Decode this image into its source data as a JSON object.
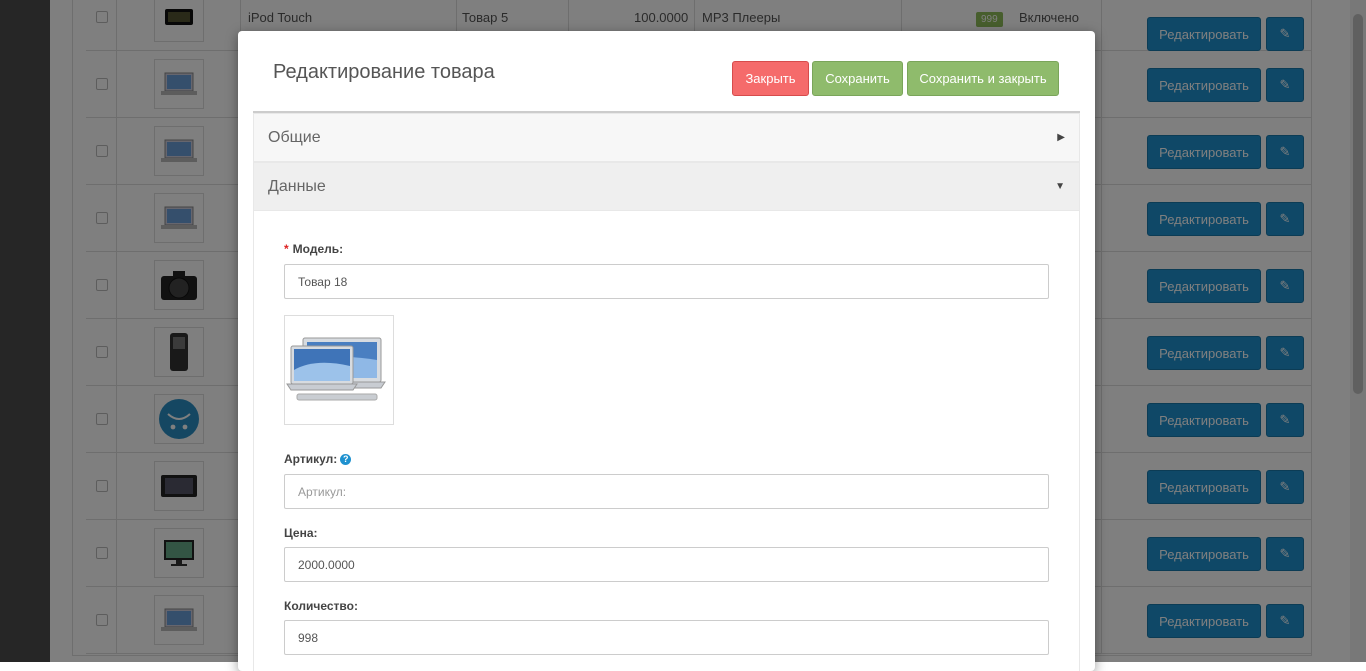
{
  "background": {
    "first_row": {
      "name": "iPod Touch",
      "model": "Товар 5",
      "price": "100.0000",
      "category": "MP3 Плееры",
      "quantity": "999",
      "status": "Включено"
    },
    "edit_label": "Редактировать",
    "row_thumbs": [
      "ipod-thumb",
      "laptop-thumb",
      "laptop-thumb",
      "laptop-thumb",
      "camera-thumb",
      "phone-thumb",
      "opencart-logo-thumb",
      "tablet-thumb",
      "monitor-thumb",
      "laptop-thumb"
    ]
  },
  "modal": {
    "title": "Редактирование товара",
    "buttons": {
      "close": "Закрыть",
      "save": "Сохранить",
      "save_close": "Сохранить и закрыть"
    },
    "panels": {
      "general": "Общие",
      "data": "Данные"
    },
    "colors": {
      "danger": "#f56b6b",
      "success": "#8fbb6c",
      "primary": "#1e91cf"
    },
    "fields": {
      "model": {
        "label": "Модель:",
        "value": "Товар 18"
      },
      "sku": {
        "label": "Артикул:",
        "value": "",
        "placeholder": "Артикул:"
      },
      "price": {
        "label": "Цена:",
        "value": "2000.0000"
      },
      "quantity": {
        "label": "Количество:",
        "value": "998"
      }
    }
  }
}
